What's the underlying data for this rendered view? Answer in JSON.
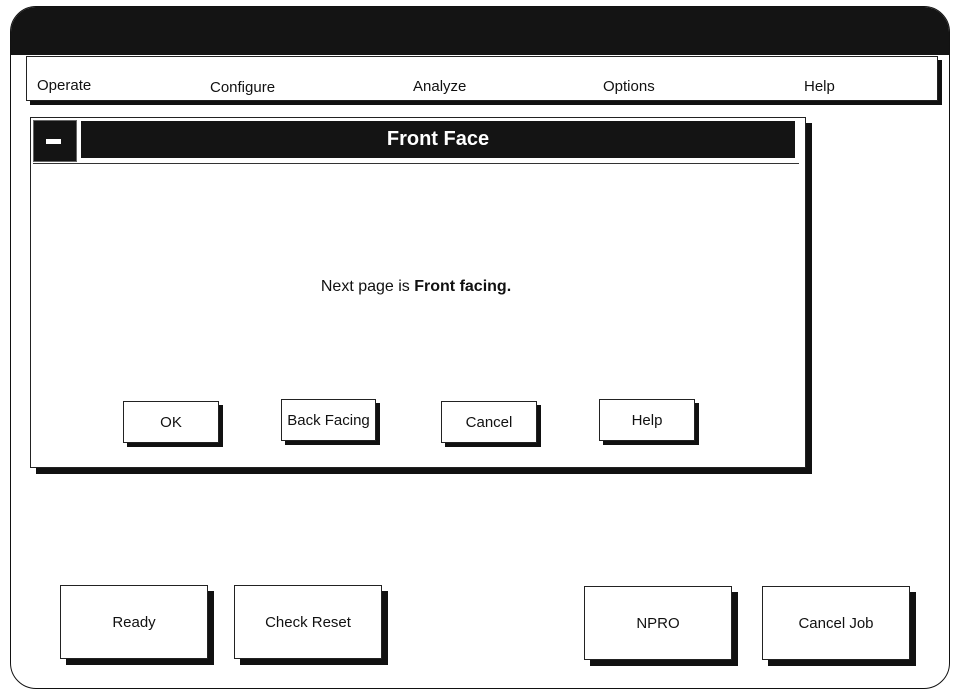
{
  "menu": {
    "items": [
      "Operate",
      "Configure",
      "Analyze",
      "Options",
      "Help"
    ]
  },
  "dialog": {
    "title": "Front Face",
    "message_prefix": "Next page is",
    "message_bold": "Front facing.",
    "buttons": {
      "ok": "OK",
      "back_facing": "Back Facing",
      "cancel": "Cancel",
      "help": "Help"
    }
  },
  "actions": {
    "ready": "Ready",
    "check_reset": "Check Reset",
    "npro": "NPRO",
    "cancel_job": "Cancel Job"
  }
}
